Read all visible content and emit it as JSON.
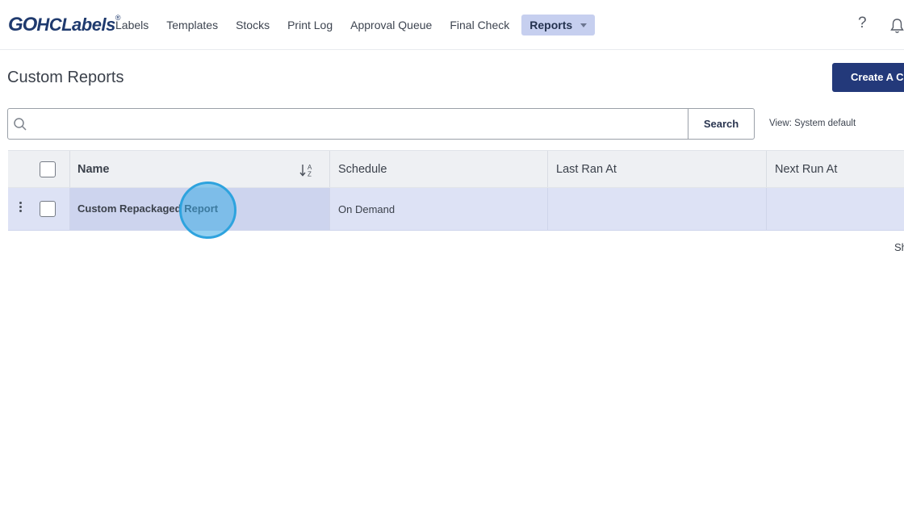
{
  "brand": {
    "mark": "GO",
    "name": "HCLabels",
    "reg": "®"
  },
  "nav": {
    "items": [
      "Labels",
      "Templates",
      "Stocks",
      "Print Log",
      "Approval Queue",
      "Final Check"
    ],
    "active": "Reports"
  },
  "header_icons": {
    "help": "?",
    "help_icon": "question-icon",
    "bell_icon": "bell-icon"
  },
  "page": {
    "title": "Custom Reports",
    "create_button": "Create A Cu"
  },
  "search": {
    "placeholder": "",
    "value": "",
    "button": "Search",
    "view_label": "View: System default"
  },
  "table": {
    "columns": [
      "Name",
      "Schedule",
      "Last Ran At",
      "Next Run At"
    ],
    "rows": [
      {
        "name": "Custom Repackaged Report",
        "schedule": "On Demand",
        "last_ran_at": "",
        "next_run_at": ""
      }
    ]
  },
  "footer": {
    "shown_text": "Sh"
  },
  "colors": {
    "accent": "#23397a",
    "active_nav": "#c6cfef",
    "selected_row": "#dde2f5",
    "click_indicator": "#2ea3de"
  }
}
